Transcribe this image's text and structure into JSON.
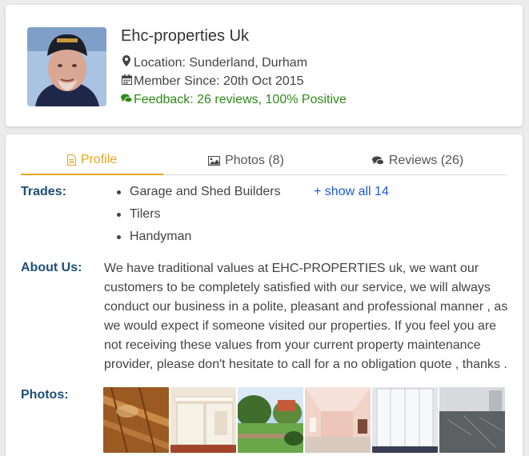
{
  "profile": {
    "business_name": "Ehc-properties Uk",
    "location": "Location: Sunderland, Durham",
    "member_since": "Member Since: 20th Oct 2015",
    "feedback": "Feedback: 26 reviews, 100% Positive"
  },
  "tabs": [
    {
      "label": "Profile",
      "icon": "document-icon",
      "active": true
    },
    {
      "label": "Photos (8)",
      "icon": "image-icon",
      "active": false
    },
    {
      "label": "Reviews (26)",
      "icon": "comments-icon",
      "active": false
    }
  ],
  "trades": {
    "label": "Trades:",
    "items": [
      "Garage and Shed Builders",
      "Tilers",
      "Handyman"
    ],
    "show_all": "+ show all 14"
  },
  "about": {
    "label": "About Us:",
    "text": "We have traditional values at EHC-PROPERTIES uk, we want our customers to be completely satisfied with our service, we will always conduct our business in a polite, pleasant and professional manner , as we would expect if someone visited our properties. If you feel you are not receiving these values from your current property maintenance provider, please don't hesitate to call for a no obligation quote , thanks ."
  },
  "photos": {
    "label": "Photos:"
  },
  "colors": {
    "accent": "#e8a51d",
    "feedback_green": "#2e8b19",
    "label_blue": "#1d4f7a",
    "link_blue": "#1a5bd6"
  }
}
